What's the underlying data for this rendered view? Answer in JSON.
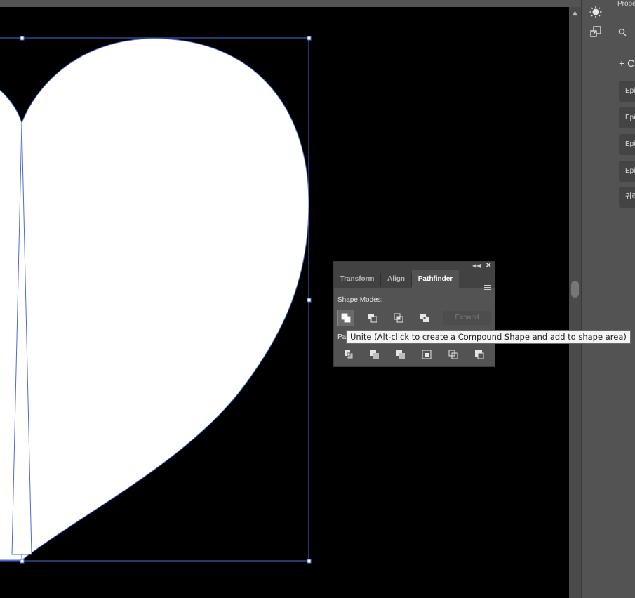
{
  "canvas": {
    "background": "#000000",
    "shape_fill": "#ffffff",
    "selection_color": "#4a6bd6"
  },
  "scrollbar": {
    "up_arrow_icon": "chevron-up-icon"
  },
  "toolstrip": {
    "items": [
      {
        "icon": "sun-icon"
      },
      {
        "icon": "artboard-export-icon"
      }
    ]
  },
  "right_panel": {
    "title": "Prope",
    "search_icon": "search-icon",
    "new_label": "+ C",
    "items": [
      "Epi",
      "Epi",
      "Epi",
      "Epi",
      "귀리"
    ]
  },
  "pathfinder_panel": {
    "collapse_icon": "double-chevron-left-icon",
    "close_icon": "close-icon",
    "tabs": [
      {
        "label": "Transform",
        "active": false
      },
      {
        "label": "Align",
        "active": false
      },
      {
        "label": "Pathfinder",
        "active": true
      }
    ],
    "menu_icon": "hamburger-menu-icon",
    "shape_modes_label": "Shape Modes:",
    "shape_modes": [
      "unite-icon",
      "minus-front-icon",
      "intersect-icon",
      "exclude-icon"
    ],
    "expand_label": "Expand",
    "pathfinders_label": "Pa",
    "pathfinders": [
      "divide-icon",
      "trim-icon",
      "merge-icon",
      "crop-icon",
      "outline-icon",
      "minus-back-icon"
    ]
  },
  "tooltip": {
    "text": "Unite (Alt-click to create a Compound Shape and add to shape area)"
  }
}
